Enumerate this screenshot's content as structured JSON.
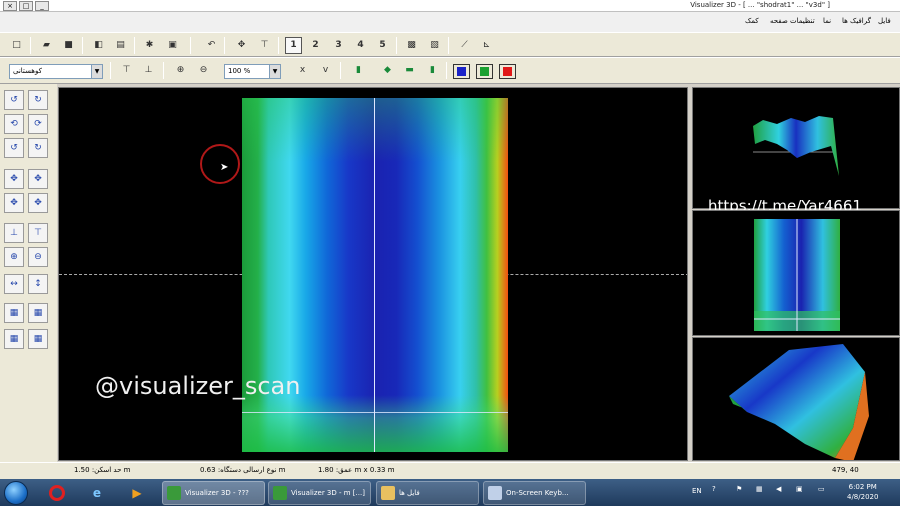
{
  "window": {
    "title": "Visualizer 3D - [ ... \"shodrat1\" ... \"v3d\" ]",
    "min": "_",
    "max": "□",
    "close": "×"
  },
  "menu": [
    "فایل",
    "گرافیک ها",
    "نما",
    "تنظیمات صفحه",
    "کمک"
  ],
  "toolbar": {
    "view_numbers": [
      "1",
      "2",
      "3",
      "4",
      "5"
    ],
    "preset_select": "کوهستانی",
    "zoom_select": "100 %"
  },
  "colors": {
    "blue_swatch": "#1a22c8",
    "green_swatch": "#1aa030",
    "red_swatch": "#e01818"
  },
  "overlays": {
    "watermark": "@visualizer_scan",
    "telegram": "https://t.me/Yar4661"
  },
  "status": {
    "left": "حد اسکن: 1.50 m",
    "mid": "نوع ارسالی دستگاه: 0.63 m",
    "mid2": "عمق: 1.80 m x 0.33 m",
    "right": "479, 40"
  },
  "taskbar": {
    "tasks": [
      "Visualizer 3D - ???",
      "Visualizer 3D - m [...]",
      "فایل ها",
      "On-Screen Keyb..."
    ],
    "lang": "EN",
    "clock_time": "6:02 PM",
    "clock_date": "4/8/2020"
  }
}
